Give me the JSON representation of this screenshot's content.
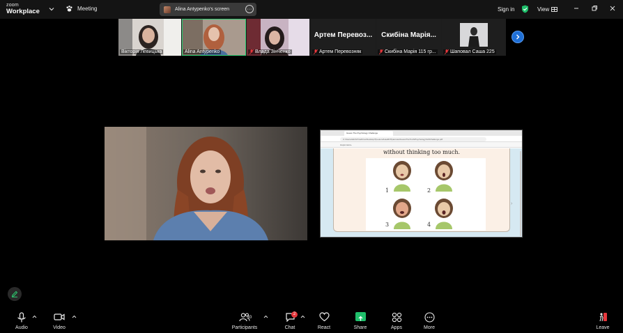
{
  "app": {
    "logo_line1": "zoom",
    "logo_line2": "Workplace"
  },
  "header": {
    "meeting_label": "Meeting",
    "screen_share_label": "Alina Antypenko's screen",
    "sign_in": "Sign in",
    "view_label": "View",
    "accent_green": "#2ecc71",
    "shield_color": "#1fbf6b"
  },
  "participants_strip": [
    {
      "name": "Вікторія Левицька",
      "muted": false
    },
    {
      "name": "Alina Antypenko",
      "muted": false,
      "active": true
    },
    {
      "name": "Влада Зінченко",
      "muted": true
    },
    {
      "big_name": "Артем Перевоз...",
      "name": "Артем Перевозняк",
      "muted": true
    },
    {
      "big_name": "Скибіна Марія...",
      "name": "Скибіна Марія 115 гр...",
      "muted": true
    },
    {
      "name": "Шаповал Саша 225",
      "muted": true
    }
  ],
  "shared_screen": {
    "tab_title": "Guess The Psychology Challenge",
    "url": "C:/Users/alinth/OneDrive/Desktop/Тренінги/Health/Практика/GuessTheTruth/Psychology%20Challenge.pdf",
    "pdf_tool_label": "Нарисовать",
    "slide_text": "without thinking too much.",
    "face_numbers": [
      "1",
      "2",
      "3",
      "4"
    ]
  },
  "toolbar": {
    "audio": "Audio",
    "video": "Video",
    "participants": "Participants",
    "participants_count": "30",
    "chat": "Chat",
    "chat_badge": "2",
    "react": "React",
    "share": "Share",
    "apps": "Apps",
    "more": "More",
    "leave": "Leave"
  }
}
